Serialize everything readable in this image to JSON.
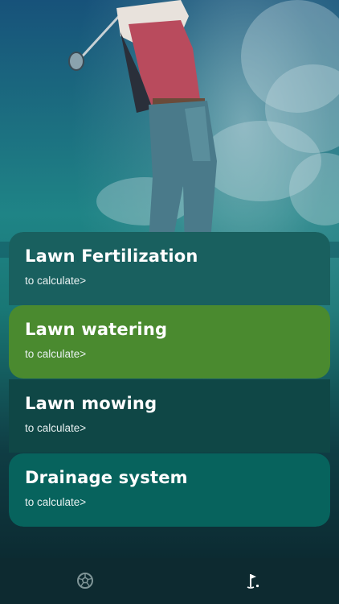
{
  "menu": {
    "items": [
      {
        "title": "Lawn Fertilization",
        "action": "to calculate>"
      },
      {
        "title": "Lawn watering",
        "action": "to calculate>"
      },
      {
        "title": "Lawn mowing",
        "action": "to calculate>"
      },
      {
        "title": "Drainage system",
        "action": "to calculate>"
      }
    ],
    "selected_index": 1
  },
  "bottom_nav": {
    "items": [
      {
        "icon": "soccer-ball-icon"
      },
      {
        "icon": "golf-flag-icon"
      }
    ]
  },
  "colors": {
    "card_default": "#19605f",
    "card_selected": "#4a8a2f",
    "card_dark": "#0f4746",
    "card_teal": "#07635d",
    "nav_background": "#0d2a30"
  }
}
